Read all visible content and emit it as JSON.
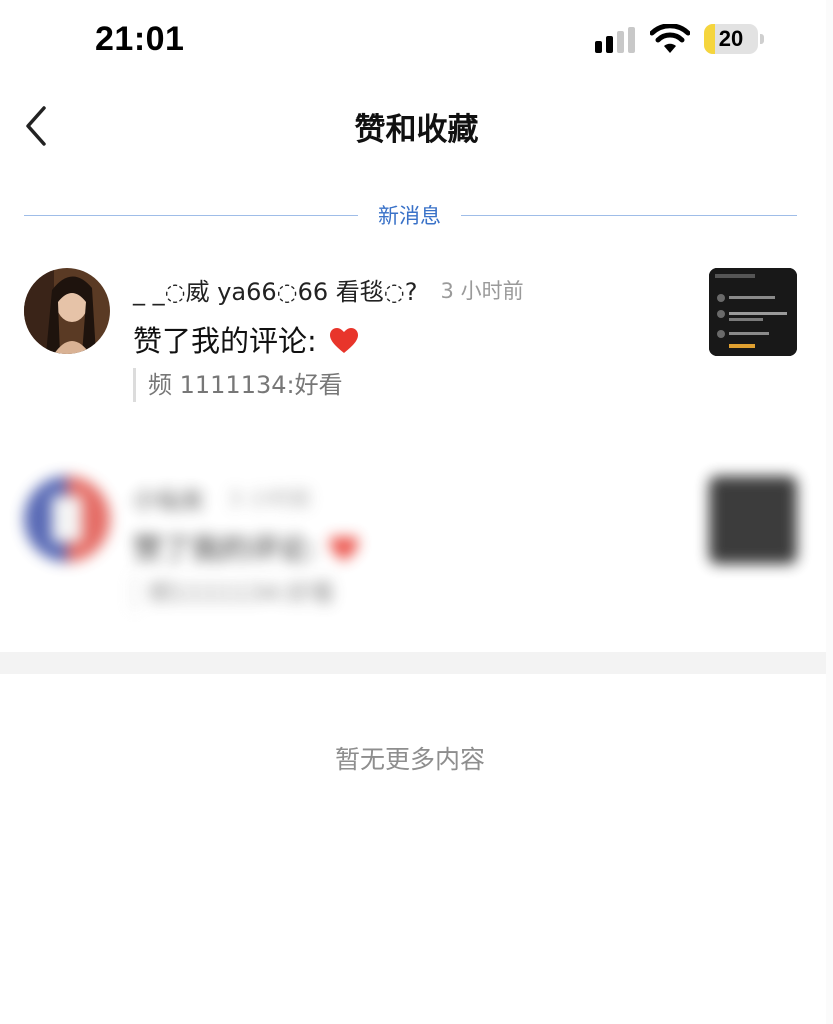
{
  "status_bar": {
    "time": "21:01",
    "battery_level": "20",
    "battery_fraction": 0.2
  },
  "nav": {
    "title": "赞和收藏"
  },
  "divider": {
    "label": "新消息"
  },
  "notifications": [
    {
      "username": "_ _◌威 ya66◌66 看毯◌?",
      "time_ago": "3 小时前",
      "action": "赞了我的评论:",
      "action_icon": "heart-icon",
      "quote": "频 1111134:好看",
      "blurred": false
    },
    {
      "username": "小仙女",
      "time_ago": "3 小时前",
      "action": "赞了我的评论:",
      "action_icon": "heart-icon",
      "quote": "频1111134:好看",
      "blurred": true
    }
  ],
  "footer": {
    "end_text": "暂无更多内容"
  },
  "colors": {
    "accent_blue": "#3a72c8",
    "divider_line": "#9fbde8",
    "heart_red": "#e8352b",
    "battery_yellow": "#f5d53d"
  }
}
